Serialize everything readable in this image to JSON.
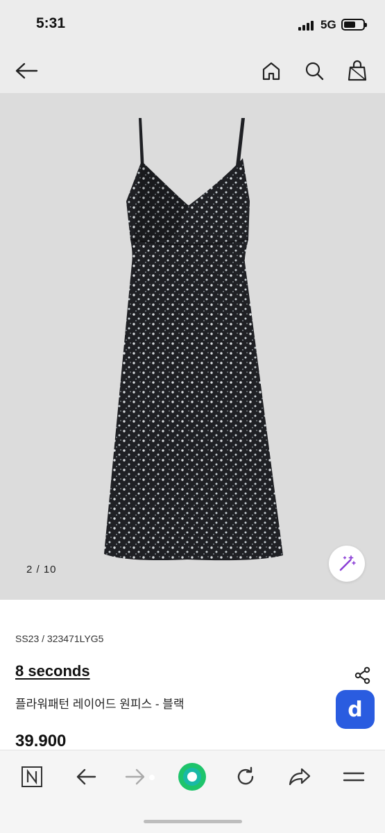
{
  "status_bar": {
    "time": "5:31",
    "network": "5G"
  },
  "top_nav": {
    "icons": [
      "back-arrow-icon",
      "home-icon",
      "search-icon",
      "shopping-bag-icon"
    ]
  },
  "gallery": {
    "page_indicator": "2 / 10",
    "ai_icon": "magic-wand-icon"
  },
  "product": {
    "code": "SS23 / 323471LYG5",
    "brand": "8 seconds",
    "name": "플라워패턴 레이어드 원피스 - 블랙",
    "price": "39.900"
  },
  "floating_badge": {
    "label": "d",
    "color": "#2a5ce0"
  },
  "browser_bar": {
    "icons": [
      "naver-n-icon",
      "back-icon",
      "forward-icon",
      "green-home-icon",
      "reload-icon",
      "share-arrow-icon",
      "menu-icon"
    ],
    "accent": "#1ec46b"
  }
}
